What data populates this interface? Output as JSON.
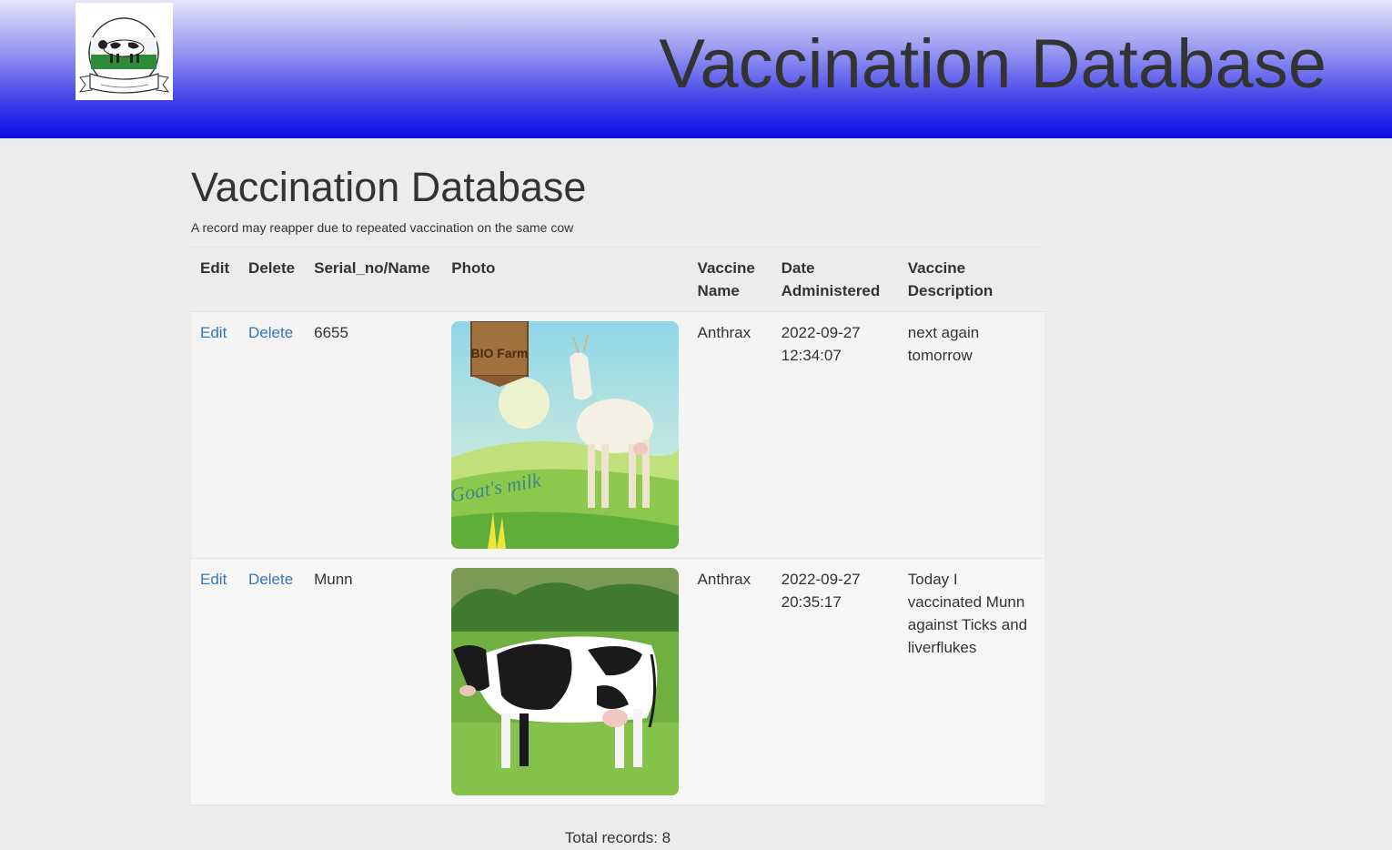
{
  "header": {
    "logo_icon": "cow-farm-logo-icon",
    "site_title": "Vaccination Database"
  },
  "main": {
    "title": "Vaccination Database",
    "subtitle": "A record may reapper due to repeated vaccination on the same cow"
  },
  "table": {
    "columns": {
      "edit": "Edit",
      "delete": "Delete",
      "serial": "Serial_no/Name",
      "photo": "Photo",
      "vaccine_name": "Vaccine Name",
      "date": "Date Administered",
      "description": "Vaccine Description"
    },
    "rows": [
      {
        "edit": "Edit",
        "delete": "Delete",
        "serial": "6655",
        "photo_icon": "goat-photo",
        "vaccine_name": "Anthrax",
        "date": "2022-09-27 12:34:07",
        "description": "next again tomorrow",
        "photo_sign": "BIO Farm",
        "photo_script": "Goat's milk"
      },
      {
        "edit": "Edit",
        "delete": "Delete",
        "serial": "Munn",
        "photo_icon": "cow-photo",
        "vaccine_name": "Anthrax",
        "date": "2022-09-27 20:35:17",
        "description": "Today I vaccinated Munn against Ticks and liverflukes"
      }
    ]
  },
  "footer": {
    "total_records": "Total records: 8"
  },
  "colors": {
    "link": "#3476b8",
    "header_gradient_top": "#e6e6f8",
    "header_gradient_bottom": "#0a0ae4"
  }
}
